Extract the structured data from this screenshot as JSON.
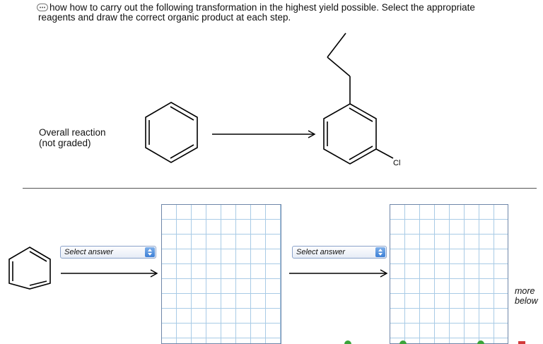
{
  "instructions": {
    "line1": "how how to carry out the following transformation in the highest yield possible. Select the appropriate",
    "line2": "reagents and draw the correct organic product at each step."
  },
  "overall": {
    "line1": "Overall reaction",
    "line2": "(not graded)",
    "substituent_label": "Cl"
  },
  "steps": [
    {
      "select_placeholder": "Select answer"
    },
    {
      "select_placeholder": "Select answer"
    }
  ],
  "more_below": {
    "line1": "more",
    "line2": "below"
  },
  "icons": [
    "chat-icon",
    "chevron-updown-icon",
    "arrow-right-icon"
  ],
  "colors": {
    "grid_line": "#a9cbe6",
    "grid_border": "#6e86a8",
    "select_border": "#8aa2c9",
    "select_accent": "#3c7fd6"
  }
}
